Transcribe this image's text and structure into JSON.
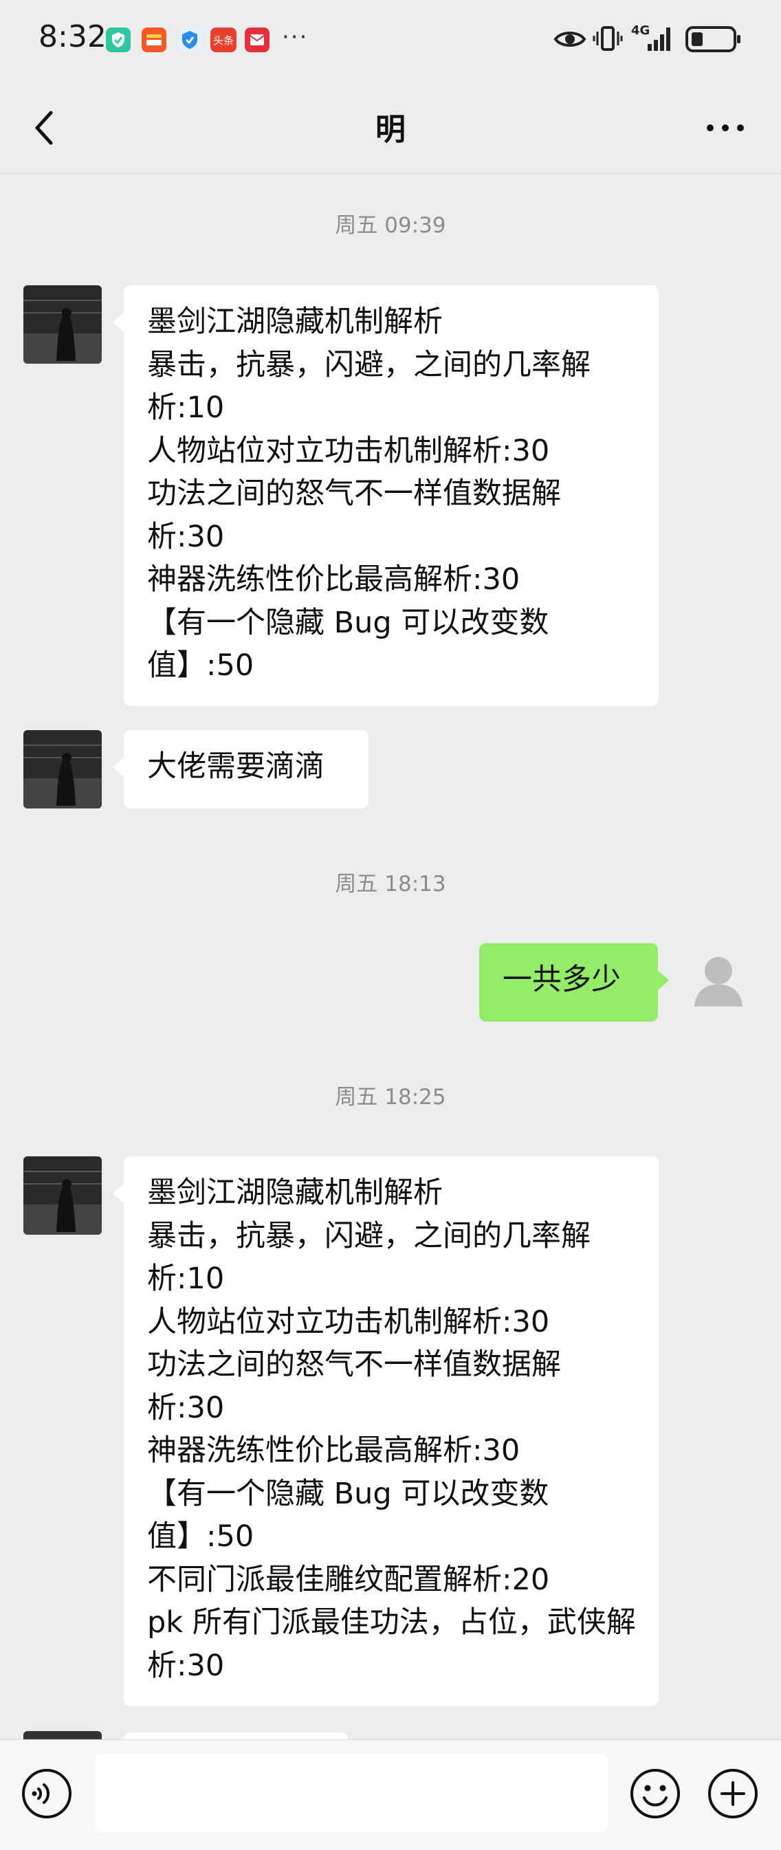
{
  "status_bar": {
    "time": "8:32",
    "more": "···",
    "network": "4G",
    "app_icons": [
      "shield-check-icon",
      "wallet-icon",
      "shield-icon",
      "toutiao-icon",
      "mail-icon"
    ]
  },
  "header": {
    "title": "明"
  },
  "messages": [
    {
      "type": "timestamp",
      "text": "周五 09:39"
    },
    {
      "type": "incoming",
      "text": "墨剑江湖隐藏机制解析\n暴击，抗暴，闪避，之间的几率解析:10\n人物站位对立功击机制解析:30\n功法之间的怒气不一样值数据解析:30\n神器洗练性价比最高解析:30\n【有一个隐藏 Bug 可以改变数值】:50"
    },
    {
      "type": "incoming",
      "text": "大佬需要滴滴"
    },
    {
      "type": "timestamp",
      "text": "周五 18:13"
    },
    {
      "type": "outgoing",
      "text": "一共多少"
    },
    {
      "type": "timestamp",
      "text": "周五 18:25"
    },
    {
      "type": "incoming",
      "text": "墨剑江湖隐藏机制解析\n暴击，抗暴，闪避，之间的几率解析:10\n人物站位对立功击机制解析:30\n功法之间的怒气不一样值数据解析:30\n神器洗练性价比最高解析:30\n【有一个隐藏 Bug 可以改变数值】:50\n不同门派最佳雕纹配置解析:20\npk 所有门派最佳功法，占位，武侠解析:30"
    }
  ],
  "input": {
    "value": "",
    "placeholder": ""
  },
  "colors": {
    "background": "#ededed",
    "outgoing_bubble": "#95ec69",
    "incoming_bubble": "#ffffff"
  }
}
